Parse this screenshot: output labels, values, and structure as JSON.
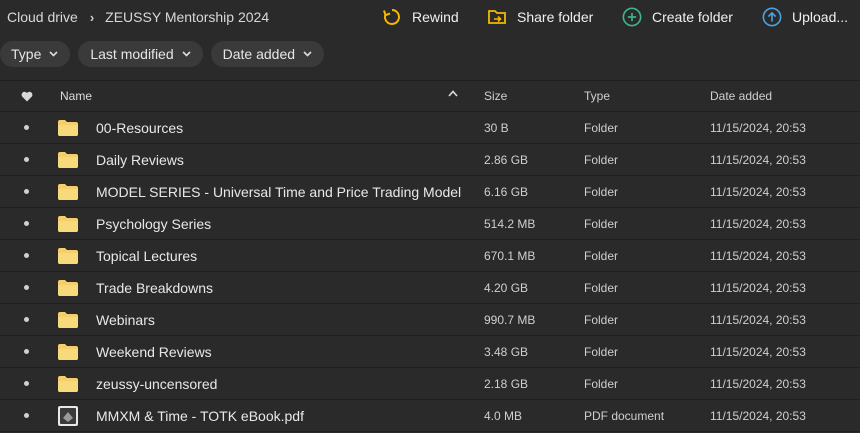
{
  "breadcrumb": {
    "root": "Cloud drive",
    "current": "ZEUSSY Mentorship 2024"
  },
  "actions": {
    "rewind": "Rewind",
    "share": "Share folder",
    "create": "Create folder",
    "upload": "Upload..."
  },
  "filters": {
    "type": "Type",
    "last_modified": "Last modified",
    "date_added": "Date added"
  },
  "columns": {
    "name": "Name",
    "size": "Size",
    "type": "Type",
    "date_added": "Date added"
  },
  "rows": [
    {
      "name": "00-Resources",
      "size": "30 B",
      "type": "Folder",
      "date": "11/15/2024, 20:53",
      "icon": "folder-icon"
    },
    {
      "name": "Daily Reviews",
      "size": "2.86 GB",
      "type": "Folder",
      "date": "11/15/2024, 20:53",
      "icon": "folder-icon"
    },
    {
      "name": "MODEL SERIES - Universal Time and Price Trading Model",
      "size": "6.16 GB",
      "type": "Folder",
      "date": "11/15/2024, 20:53",
      "icon": "folder-icon"
    },
    {
      "name": "Psychology Series",
      "size": "514.2 MB",
      "type": "Folder",
      "date": "11/15/2024, 20:53",
      "icon": "folder-icon"
    },
    {
      "name": "Topical Lectures",
      "size": "670.1 MB",
      "type": "Folder",
      "date": "11/15/2024, 20:53",
      "icon": "folder-icon"
    },
    {
      "name": "Trade Breakdowns",
      "size": "4.20 GB",
      "type": "Folder",
      "date": "11/15/2024, 20:53",
      "icon": "folder-icon"
    },
    {
      "name": "Webinars",
      "size": "990.7 MB",
      "type": "Folder",
      "date": "11/15/2024, 20:53",
      "icon": "folder-icon"
    },
    {
      "name": "Weekend Reviews",
      "size": "3.48 GB",
      "type": "Folder",
      "date": "11/15/2024, 20:53",
      "icon": "folder-icon"
    },
    {
      "name": "zeussy-uncensored",
      "size": "2.18 GB",
      "type": "Folder",
      "date": "11/15/2024, 20:53",
      "icon": "folder-icon"
    },
    {
      "name": "MMXM & Time - TOTK eBook.pdf",
      "size": "4.0 MB",
      "type": "PDF document",
      "date": "11/15/2024, 20:53",
      "icon": "pdf-file-icon"
    }
  ],
  "colors": {
    "accent_yellow": "#f5b800",
    "accent_green": "#3bb68a",
    "accent_blue": "#4aa3df",
    "folder": "#f3cf6e"
  }
}
